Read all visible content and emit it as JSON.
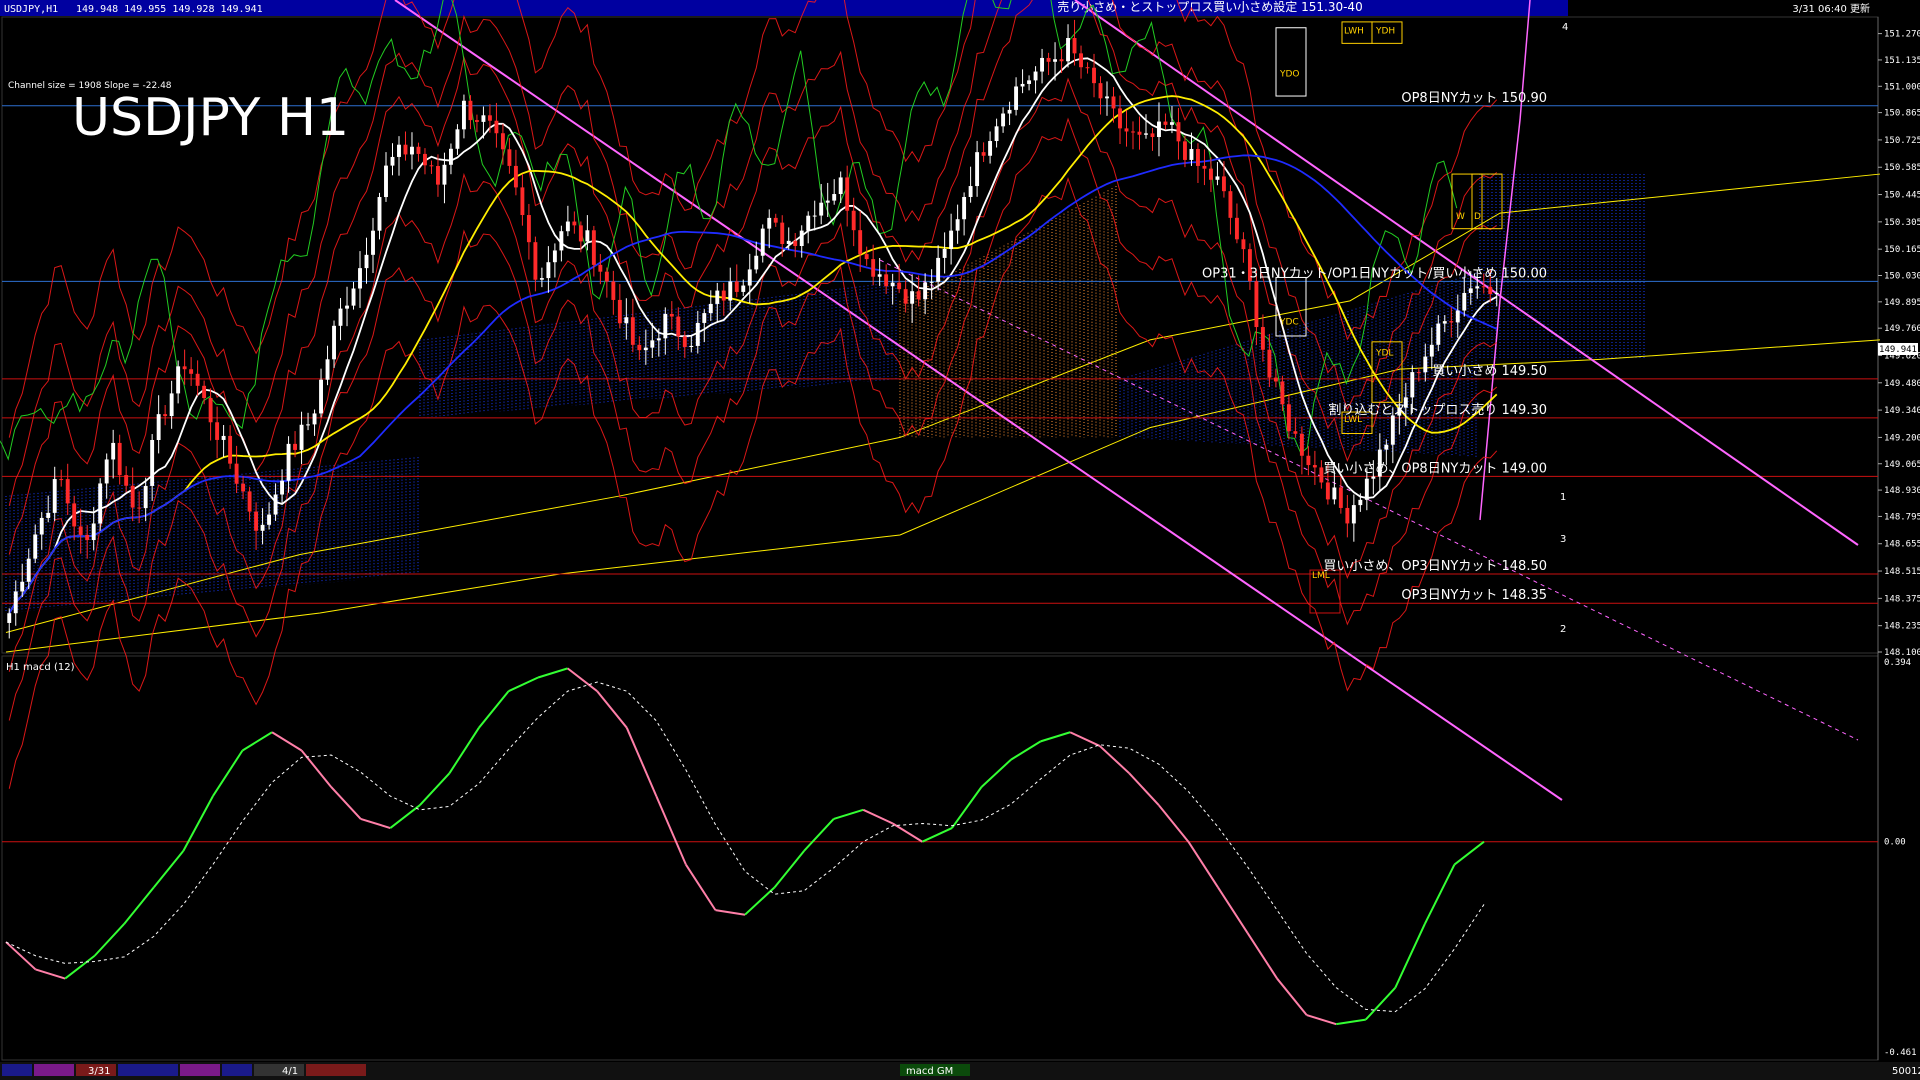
{
  "chart_header": {
    "symbol_info": "USDJPY,H1",
    "ohlc": "149.948 149.955 149.928 149.941",
    "update_time": "3/31 06:40 更新",
    "top_banner": "売り小さめ・とストップロス買い小さめ設定 151.30-40"
  },
  "big_title": "USDJPY H1",
  "channel_info": "Channel size = 1908 Slope = -22.48",
  "macd_label": "H1 macd (12)",
  "bottom_bar": {
    "date_labels": [
      "3/31",
      "4/1"
    ],
    "tab_label": "macd GM",
    "code": "50012"
  },
  "colors": {
    "bull": "#ffffff",
    "bear": "#ff2a2a",
    "ma_white": "#ffffff",
    "ma_yellow": "#ffee00",
    "ma_blue": "#1f2bff",
    "channel": "#ff66ff",
    "bollinger": "#ff1b1b",
    "chikou": "#22cc22",
    "cloud_blue": "#1430c8",
    "cloud_brown": "#c8742a",
    "level_red": "#cc1111",
    "level_blue": "#2d6fd0",
    "macd_up": "#33ff33",
    "macd_down": "#ff7fa8",
    "signal": "#ffffff"
  },
  "chart_data": {
    "type": "candlestick",
    "symbol": "USDJPY",
    "timeframe": "H1",
    "ylim": [
      148.1,
      151.35
    ],
    "y_ticks": [
      "151.270",
      "151.135",
      "151.000",
      "150.865",
      "150.725",
      "150.585",
      "150.445",
      "150.305",
      "150.165",
      "150.030",
      "149.895",
      "149.760",
      "149.620",
      "149.480",
      "149.340",
      "149.200",
      "149.065",
      "148.930",
      "148.795",
      "148.655",
      "148.515",
      "148.375",
      "148.235",
      "148.100"
    ],
    "current_price": "149.941",
    "close_path": [
      148.3,
      148.7,
      149.0,
      148.6,
      149.2,
      148.8,
      149.3,
      149.6,
      149.3,
      149.0,
      148.7,
      149.1,
      149.3,
      149.8,
      150.1,
      150.6,
      150.7,
      150.5,
      150.9,
      150.8,
      150.5,
      150.0,
      150.3,
      150.2,
      149.9,
      149.6,
      149.8,
      149.7,
      149.9,
      150.0,
      150.3,
      150.2,
      150.4,
      150.5,
      150.1,
      150.0,
      149.9,
      150.1,
      150.5,
      150.8,
      151.0,
      151.1,
      151.2,
      151.0,
      150.8,
      150.7,
      150.8,
      150.6,
      150.5,
      150.1,
      149.5,
      149.2,
      149.0,
      148.8,
      149.0,
      149.3,
      149.6,
      149.8,
      150.0,
      149.94
    ],
    "levels": [
      {
        "label": "OP8日NYカット 150.90",
        "value": 150.9
      },
      {
        "label": "OP31・3日NYカット/OP1日NYカット/買い小さめ 150.00",
        "value": 150.0
      },
      {
        "label": "買い小さめ 149.50",
        "value": 149.5
      },
      {
        "label": "割り込むとストップロス売り 149.30",
        "value": 149.3
      },
      {
        "label": "買い小さめ、OP8日NYカット 149.00",
        "value": 149.0
      },
      {
        "label": "買い小さめ、OP3日NYカット 148.50",
        "value": 148.5
      },
      {
        "label": "OP3日NYカット 148.35",
        "value": 148.35
      }
    ],
    "boxes": [
      "YDO",
      "YDC",
      "YDL",
      "YDH",
      "LWH",
      "LWL",
      "LML",
      "W",
      "D"
    ],
    "projection_labels": [
      "4",
      "1",
      "3",
      "2"
    ],
    "macd": {
      "ylim": [
        -0.461,
        0.394
      ],
      "y_ticks": [
        "0.394",
        "0.00",
        "-0.461"
      ],
      "values": [
        -0.22,
        -0.28,
        -0.3,
        -0.25,
        -0.18,
        -0.1,
        -0.02,
        0.1,
        0.2,
        0.24,
        0.2,
        0.12,
        0.05,
        0.03,
        0.08,
        0.15,
        0.25,
        0.33,
        0.36,
        0.38,
        0.33,
        0.25,
        0.1,
        -0.05,
        -0.15,
        -0.16,
        -0.1,
        -0.02,
        0.05,
        0.07,
        0.04,
        0.0,
        0.03,
        0.12,
        0.18,
        0.22,
        0.24,
        0.21,
        0.15,
        0.08,
        0.0,
        -0.1,
        -0.2,
        -0.3,
        -0.38,
        -0.4,
        -0.39,
        -0.32,
        -0.18,
        -0.05,
        0.0
      ]
    }
  }
}
